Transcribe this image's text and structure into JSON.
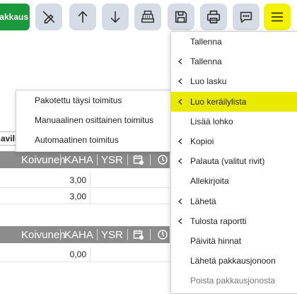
{
  "toolbar": {
    "primary_label": "pakkaus",
    "buttons": [
      {
        "icon": "no-edit-icon"
      },
      {
        "icon": "arrow-up-icon"
      },
      {
        "icon": "arrow-down-icon"
      },
      {
        "icon": "cash-register-icon"
      },
      {
        "icon": "save-icon"
      },
      {
        "icon": "print-icon"
      },
      {
        "icon": "chat-icon"
      },
      {
        "icon": "hamburger-menu-icon"
      }
    ],
    "active_color": "#f4f200",
    "primary_color": "#1a9a3c"
  },
  "grid": {
    "fragment_label": "avill",
    "header1": {
      "col1": "Koivunen",
      "col2": "KAHA",
      "col3": "YSR"
    },
    "rows1": [
      {
        "value": "3,00"
      },
      {
        "value": "3,00"
      }
    ],
    "header2": {
      "col1": "Koivunen",
      "col2": "KAHA",
      "col3": "YSR"
    },
    "rows2": [
      {
        "value": "0,00"
      }
    ]
  },
  "submenu": {
    "items": [
      {
        "label": "Pakotettu täysi toimitus"
      },
      {
        "label": "Manuaalinen osittainen toimitus"
      },
      {
        "label": "Automaatinen toimitus"
      }
    ]
  },
  "menu": {
    "highlight_color": "#eaea00",
    "items": [
      {
        "label": "Tallenna",
        "chevron": false
      },
      {
        "label": "Tallenna",
        "chevron": true
      },
      {
        "label": "Luo lasku",
        "chevron": true
      },
      {
        "label": "Luo keräilylista",
        "chevron": true,
        "highlighted": true
      },
      {
        "label": "Lisää lohko",
        "chevron": false
      },
      {
        "label": "Kopioi",
        "chevron": true
      },
      {
        "label": "Palauta (valitut rivit)",
        "chevron": true
      },
      {
        "label": "Allekirjoita",
        "chevron": false
      },
      {
        "label": "Lähetä",
        "chevron": true
      },
      {
        "label": "Tulosta raportti",
        "chevron": true
      },
      {
        "label": "Päivitä hinnat",
        "chevron": false
      },
      {
        "label": "Lähetä pakkausjonoon",
        "chevron": false
      },
      {
        "label": "Poista pakkausjonosta",
        "chevron": false,
        "dimmed": true
      }
    ]
  }
}
